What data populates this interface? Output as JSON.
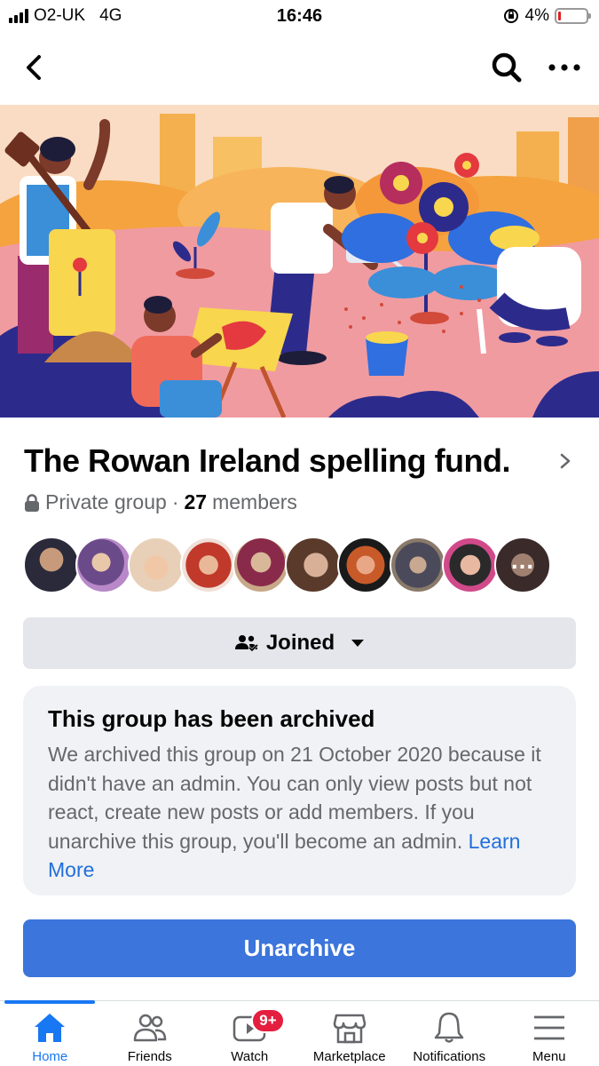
{
  "status_bar": {
    "carrier": "O2-UK",
    "network": "4G",
    "time": "16:46",
    "battery": "4%",
    "battery_level": 0.04
  },
  "nav": {
    "back_icon": "chevron-left-icon",
    "search_icon": "search-icon",
    "more_icon": "more-icon"
  },
  "group": {
    "title": "The Rowan Ireland spelling fund.",
    "privacy": "Private group",
    "separator": "·",
    "member_count": "27",
    "members_label": "members",
    "member_avatars": 10
  },
  "joined_button": {
    "label": "Joined"
  },
  "archive_notice": {
    "title": "This group has been archived",
    "body": "We archived this group on 21 October 2020 because it didn't have an admin. You can only view posts but not react, create new posts or add members. If you unarchive this group, you'll become an admin.",
    "link": "Learn More"
  },
  "unarchive_button": {
    "label": "Unarchive"
  },
  "tabbar": {
    "tabs": [
      {
        "label": "Home",
        "icon": "home-icon",
        "active": true
      },
      {
        "label": "Friends",
        "icon": "friends-icon"
      },
      {
        "label": "Watch",
        "icon": "watch-icon",
        "badge": "9+"
      },
      {
        "label": "Marketplace",
        "icon": "marketplace-icon"
      },
      {
        "label": "Notifications",
        "icon": "bell-icon"
      },
      {
        "label": "Menu",
        "icon": "menu-icon"
      }
    ]
  },
  "colors": {
    "accent": "#1877f2",
    "button_blue": "#3c75db",
    "link": "#216fdb",
    "badge": "#e41e3f"
  }
}
